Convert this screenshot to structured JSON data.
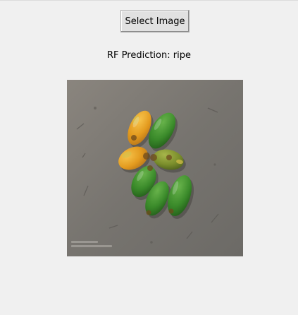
{
  "window": {
    "select_button_label": "Select Image",
    "prediction_text": "RF Prediction: ripe"
  },
  "image": {
    "subject": "areca nuts on concrete",
    "colors": {
      "background": "#f0f0f0",
      "concrete": "#7d7a75",
      "ripe": "#e6a020",
      "unripe": "#3f8a2a"
    }
  }
}
